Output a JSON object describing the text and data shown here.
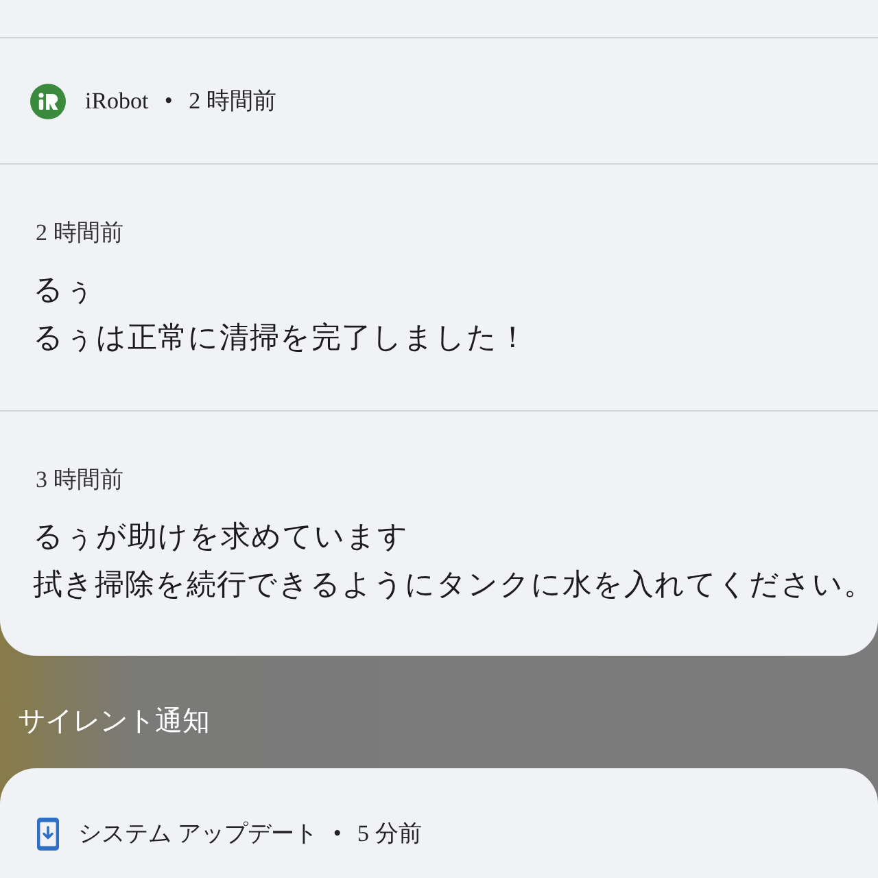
{
  "notification_card": {
    "app_header": {
      "app_name": "iRobot",
      "separator": "•",
      "time": "2 時間前"
    },
    "messages": [
      {
        "time": "2 時間前",
        "title": "るぅ",
        "body": "るぅは正常に清掃を完了しました！"
      },
      {
        "time": "3 時間前",
        "title": "るぅが助けを求めています",
        "body": "拭き掃除を続行できるようにタンクに水を入れてください。"
      }
    ]
  },
  "silent_section": {
    "heading": "サイレント通知"
  },
  "silent_card": {
    "app_name": "システム アップデート",
    "separator": "•",
    "time": "5 分前"
  }
}
